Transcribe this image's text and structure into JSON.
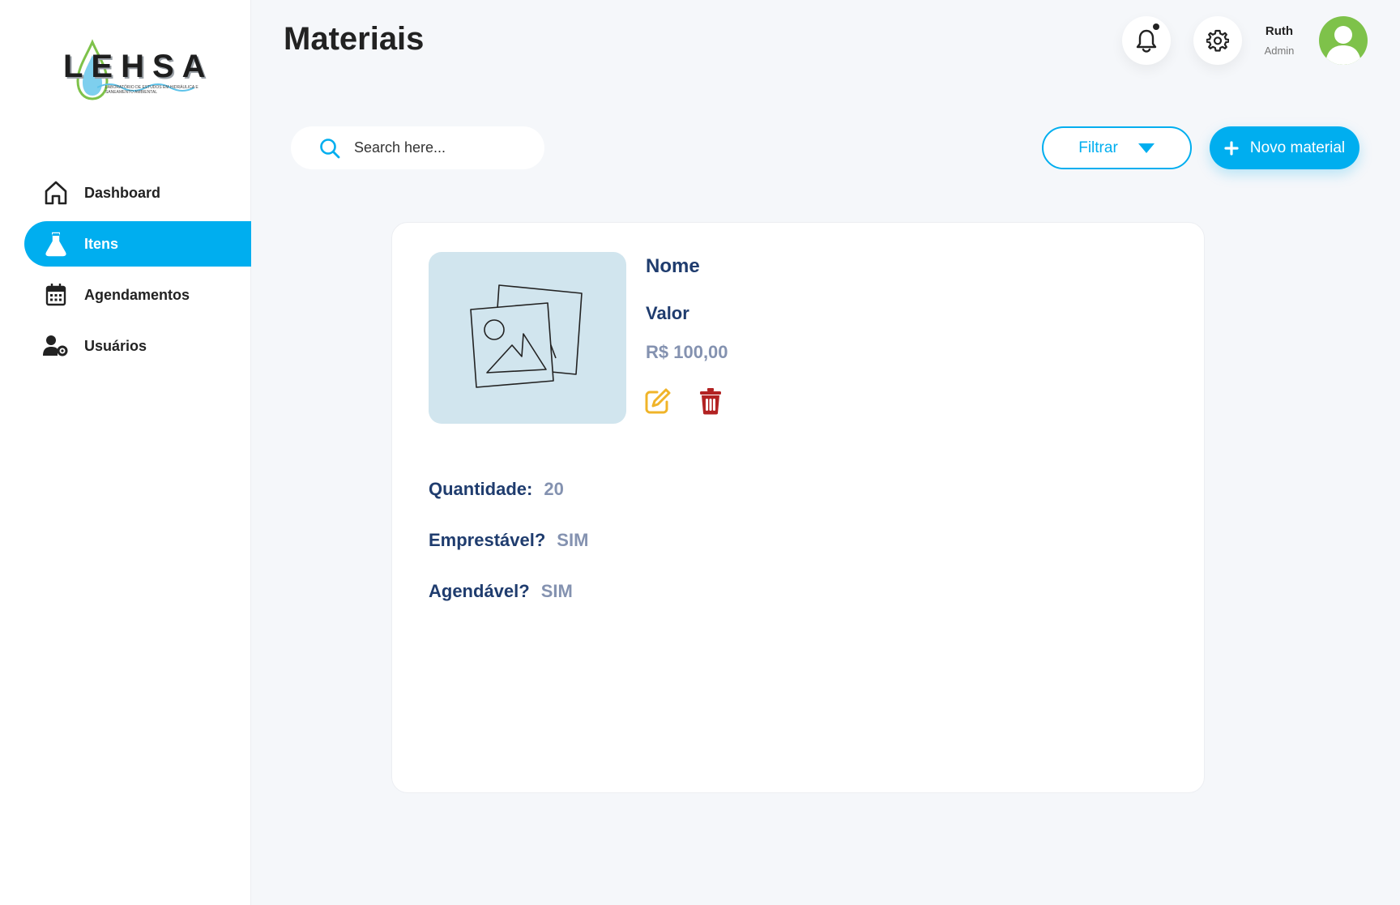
{
  "app": {
    "logo_text": "LEHSA",
    "logo_subtitle": "LABORATÓRIO DE ESTUDOS EM HIDRÁULICA E SANEAMENTO AMBIENTAL"
  },
  "sidebar": {
    "items": [
      {
        "label": "Dashboard",
        "icon": "home-icon",
        "active": false
      },
      {
        "label": "Itens",
        "icon": "flask-icon",
        "active": true
      },
      {
        "label": "Agendamentos",
        "icon": "calendar-icon",
        "active": false
      },
      {
        "label": "Usuários",
        "icon": "user-gear-icon",
        "active": false
      }
    ]
  },
  "header": {
    "title": "Materiais",
    "user_name": "Ruth",
    "user_role": "Admin"
  },
  "toolbar": {
    "search_placeholder": "Search here...",
    "filter_label": "Filtrar",
    "new_label": "Novo material"
  },
  "card": {
    "name_label": "Nome",
    "valor_label": "Valor",
    "price": "R$ 100,00",
    "fields": [
      {
        "key": "Quantidade:",
        "value": "20"
      },
      {
        "key": "Emprestável?",
        "value": "SIM"
      },
      {
        "key": "Agendável?",
        "value": "SIM"
      }
    ]
  },
  "colors": {
    "accent": "#00aeef",
    "navy": "#1f3c6e",
    "muted": "#8492b0",
    "edit": "#f0b429",
    "delete": "#b22222",
    "avatar": "#7ec24a"
  }
}
